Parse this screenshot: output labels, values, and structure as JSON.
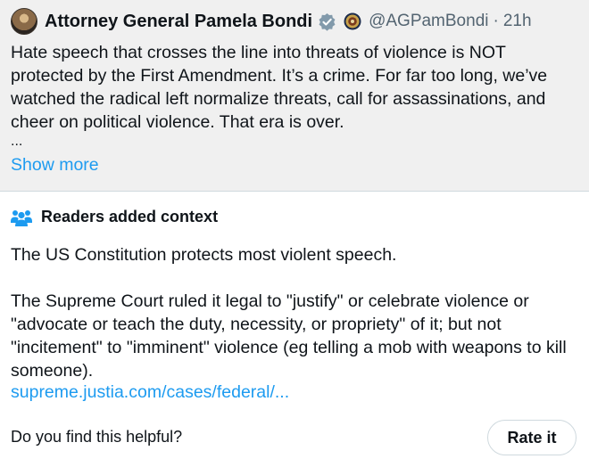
{
  "tweet": {
    "display_name": "Attorney General Pamela Bondi",
    "handle": "@AGPamBondi",
    "separator": "·",
    "time": "21h",
    "text": "Hate speech that crosses the line into threats of violence is NOT protected by the First Amendment. It’s a crime. For far too long, we’ve watched the radical left normalize threats, call for assassinations, and cheer on political violence. That era is over.",
    "ellipsis": "...",
    "show_more": "Show more",
    "icons": {
      "avatar": "profile-avatar",
      "verified": "verified-badge-icon",
      "affiliation": "doj-seal-icon"
    }
  },
  "community_note": {
    "title": "Readers added context",
    "icon": "people-icon",
    "paragraph_1": "The US Constitution protects most violent speech.",
    "paragraph_2": "The Supreme Court ruled it legal to \"justify\" or celebrate violence or \"advocate or teach the duty, necessity, or propriety\" of it; but not \"incitement\" to \"imminent\" violence (eg telling a mob with weapons to kill someone).",
    "link": "supreme.justia.com/cases/federal/...",
    "helpful_question": "Do you find this helpful?",
    "rate_label": "Rate it"
  },
  "colors": {
    "link": "#1d9bf0",
    "tweet_background": "#f0f0f0",
    "text": "#0f1419",
    "secondary_text": "#536471",
    "border": "#cfd9de"
  }
}
